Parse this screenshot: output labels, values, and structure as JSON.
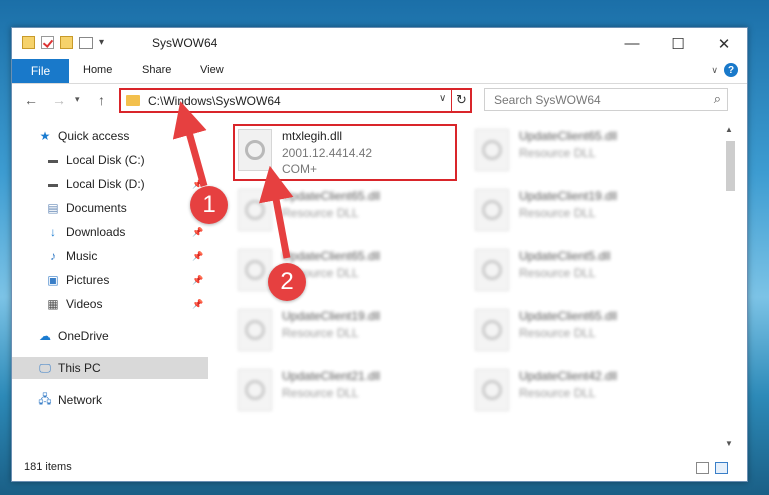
{
  "window": {
    "title": "SysWOW64",
    "qat_dropdown": "▾",
    "minimize": "—",
    "maximize": "☐",
    "close": "✕"
  },
  "ribbon": {
    "file": "File",
    "tabs": [
      "Home",
      "Share",
      "View"
    ],
    "help": "?"
  },
  "nav": {
    "back": "←",
    "forward": "→",
    "recent": "▾",
    "up": "↑",
    "address": "C:\\Windows\\SysWOW64",
    "address_dropdown": "∨",
    "refresh": "↻",
    "search_placeholder": "Search SysWOW64",
    "search_icon": "⌕"
  },
  "sidebar": {
    "items": [
      {
        "label": "Quick access",
        "icon": "star-icon"
      },
      {
        "label": "Local Disk (C:)",
        "icon": "drive-icon"
      },
      {
        "label": "Local Disk (D:)",
        "icon": "drive-icon"
      },
      {
        "label": "Documents",
        "icon": "documents-icon"
      },
      {
        "label": "Downloads",
        "icon": "downloads-icon"
      },
      {
        "label": "Music",
        "icon": "music-icon"
      },
      {
        "label": "Pictures",
        "icon": "pictures-icon"
      },
      {
        "label": "Videos",
        "icon": "videos-icon"
      },
      {
        "label": "OneDrive",
        "icon": "cloud-icon"
      },
      {
        "label": "This PC",
        "icon": "pc-icon"
      },
      {
        "label": "Network",
        "icon": "network-icon"
      }
    ],
    "pin": "📌"
  },
  "files": {
    "main": {
      "name": "mtxlegih.dll",
      "version": "2001.12.4414.42",
      "company": "COM+"
    },
    "left_column": [
      {
        "name": "UpdateClient65.dll",
        "desc": "Resource DLL"
      },
      {
        "name": "UpdateClient65.dll",
        "desc": "Resource DLL"
      },
      {
        "name": "UpdateClient19.dll",
        "desc": "Resource DLL"
      },
      {
        "name": "UpdateClient21.dll",
        "desc": "Resource DLL"
      }
    ],
    "right_column": [
      {
        "name": "UpdateClient65.dll",
        "desc": "Resource DLL"
      },
      {
        "name": "UpdateClient19.dll",
        "desc": "Resource DLL"
      },
      {
        "name": "UpdateClient5.dll",
        "desc": "Resource DLL"
      },
      {
        "name": "UpdateClient65.dll",
        "desc": "Resource DLL"
      },
      {
        "name": "UpdateClient42.dll",
        "desc": "Resource DLL"
      }
    ]
  },
  "scroll": {
    "up": "▲",
    "down": "▼"
  },
  "status": {
    "count": "181 items"
  },
  "annotations": {
    "step1": "1",
    "step2": "2",
    "color": "#e64040"
  }
}
